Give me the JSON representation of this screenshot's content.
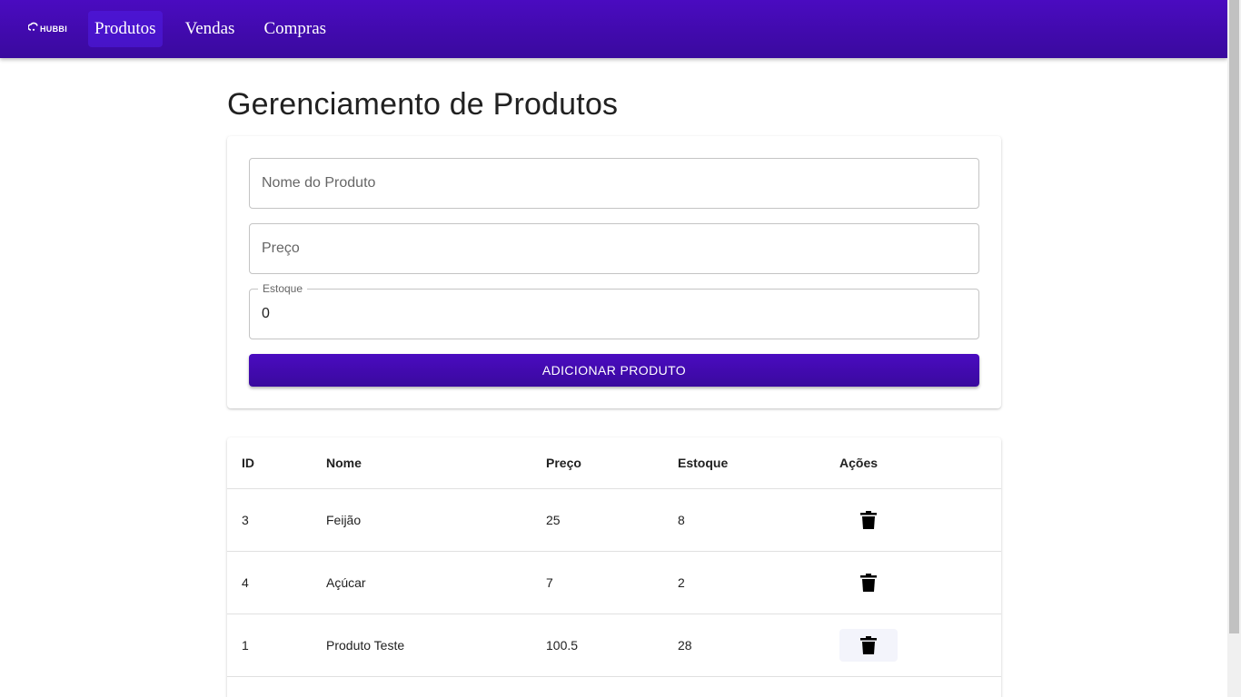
{
  "appbar": {
    "logo_text": "HUBBI",
    "nav": [
      {
        "label": "Produtos",
        "active": true
      },
      {
        "label": "Vendas",
        "active": false
      },
      {
        "label": "Compras",
        "active": false
      }
    ],
    "color": "#3f0aaf"
  },
  "page": {
    "title": "Gerenciamento de Produtos"
  },
  "form": {
    "name_placeholder": "Nome do Produto",
    "name_value": "",
    "price_placeholder": "Preço",
    "price_value": "",
    "stock_label": "Estoque",
    "stock_value": "0",
    "add_button_label": "ADICIONAR PRODUTO"
  },
  "table": {
    "headers": {
      "id": "ID",
      "nome": "Nome",
      "preco": "Preço",
      "estoque": "Estoque",
      "acoes": "Ações"
    },
    "rows": [
      {
        "id": "3",
        "nome": "Feijão",
        "preco": "25",
        "estoque": "8"
      },
      {
        "id": "4",
        "nome": "Açúcar",
        "preco": "7",
        "estoque": "2"
      },
      {
        "id": "1",
        "nome": "Produto Teste",
        "preco": "100.5",
        "estoque": "28"
      }
    ],
    "action_icon": "trash-icon"
  }
}
